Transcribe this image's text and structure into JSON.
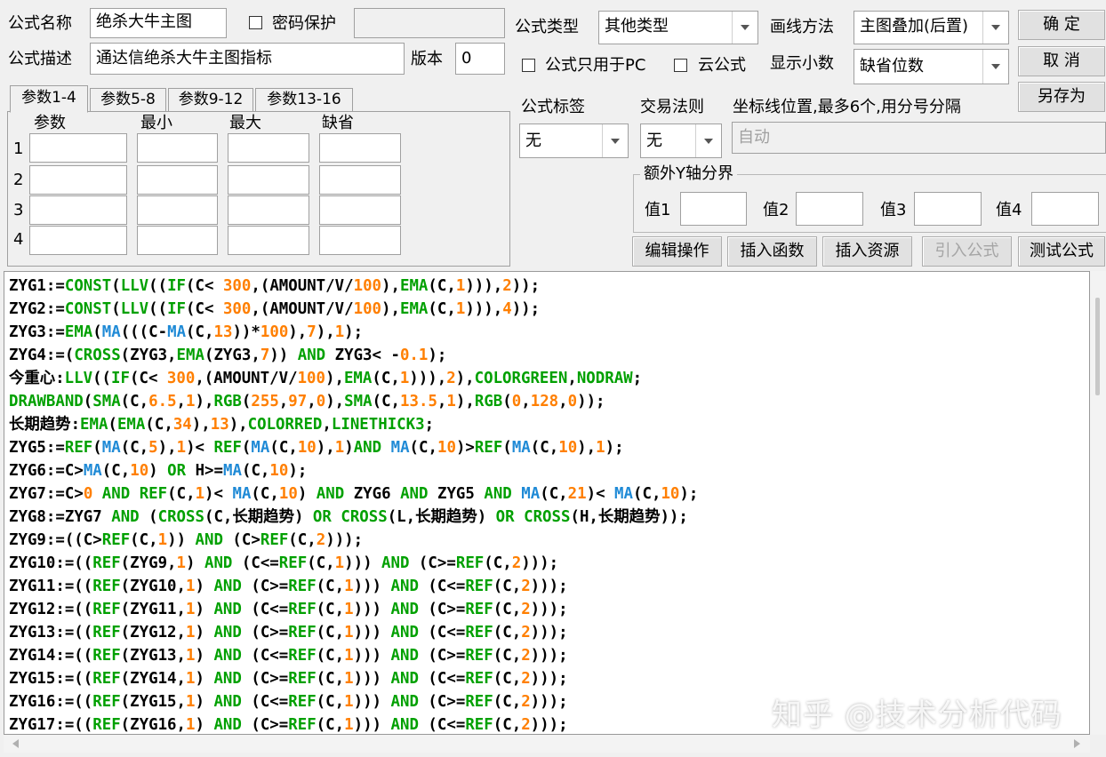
{
  "header": {
    "name_label": "公式名称",
    "name_value": "绝杀大牛主图",
    "password_label": "密码保护",
    "password_value": "",
    "desc_label": "公式描述",
    "desc_value": "通达信绝杀大牛主图指标",
    "version_label": "版本",
    "version_value": "0",
    "type_label": "公式类型",
    "type_value": "其他类型",
    "draw_label": "画线方法",
    "draw_value": "主图叠加(后置)",
    "pc_only_label": "公式只用于PC",
    "cloud_label": "云公式",
    "decimal_label": "显示小数",
    "decimal_value": "缺省位数"
  },
  "buttons": {
    "ok": "确  定",
    "cancel": "取  消",
    "save_as": "另存为",
    "edit_op": "编辑操作",
    "insert_func": "插入函数",
    "insert_res": "插入资源",
    "import_formula": "引入公式",
    "test_formula": "测试公式"
  },
  "params": {
    "tabs": [
      "参数1-4",
      "参数5-8",
      "参数9-12",
      "参数13-16"
    ],
    "columns": [
      "参数",
      "最小",
      "最大",
      "缺省"
    ],
    "rows": [
      "1",
      "2",
      "3",
      "4"
    ]
  },
  "tag": {
    "formula_tag_label": "公式标签",
    "formula_tag_value": "无",
    "trade_rule_label": "交易法则",
    "trade_rule_value": "无",
    "coord_label": "坐标线位置,最多6个,用分号分隔",
    "coord_value": "自动"
  },
  "yaxis": {
    "title": "额外Y轴分界",
    "labels": [
      "值1",
      "值2",
      "值3",
      "值4"
    ]
  },
  "code_lines": [
    "ZYG1:=CONST(LLV((IF(C< 300,(AMOUNT/V/100),EMA(C,1))),2));",
    "ZYG2:=CONST(LLV((IF(C< 300,(AMOUNT/V/100),EMA(C,1))),4));",
    "ZYG3:=EMA(MA(((C-MA(C,13))*100),7),1);",
    "ZYG4:=(CROSS(ZYG3,EMA(ZYG3,7)) AND ZYG3< -0.1);",
    "今重心:LLV((IF(C< 300,(AMOUNT/V/100),EMA(C,1))),2),COLORGREEN,NODRAW;",
    "DRAWBAND(SMA(C,6.5,1),RGB(255,97,0),SMA(C,13.5,1),RGB(0,128,0));",
    "长期趋势:EMA(EMA(C,34),13),COLORRED,LINETHICK3;",
    "ZYG5:=REF(MA(C,5),1)< REF(MA(C,10),1)AND MA(C,10)>REF(MA(C,10),1);",
    "ZYG6:=C>MA(C,10) OR H>=MA(C,10);",
    "ZYG7:=C>0 AND REF(C,1)< MA(C,10) AND ZYG6 AND ZYG5 AND MA(C,21)< MA(C,10);",
    "ZYG8:=ZYG7 AND (CROSS(C,长期趋势) OR CROSS(L,长期趋势) OR CROSS(H,长期趋势));",
    "ZYG9:=((C>REF(C,1)) AND (C>REF(C,2)));",
    "ZYG10:=((REF(ZYG9,1) AND (C<=REF(C,1))) AND (C>=REF(C,2)));",
    "ZYG11:=((REF(ZYG10,1) AND (C>=REF(C,1))) AND (C<=REF(C,2)));",
    "ZYG12:=((REF(ZYG11,1) AND (C<=REF(C,1))) AND (C>=REF(C,2)));",
    "ZYG13:=((REF(ZYG12,1) AND (C>=REF(C,1))) AND (C<=REF(C,2)));",
    "ZYG14:=((REF(ZYG13,1) AND (C<=REF(C,1))) AND (C>=REF(C,2)));",
    "ZYG15:=((REF(ZYG14,1) AND (C>=REF(C,1))) AND (C<=REF(C,2)));",
    "ZYG16:=((REF(ZYG15,1) AND (C<=REF(C,1))) AND (C>=REF(C,2)));",
    "ZYG17:=((REF(ZYG16,1) AND (C>=REF(C,1))) AND (C<=REF(C,2)));"
  ],
  "watermark": "知乎 @技术分析代码",
  "colors": {
    "keyword": "#00a000",
    "number": "#ff7f00",
    "function_ma": "#1f8ad6"
  }
}
